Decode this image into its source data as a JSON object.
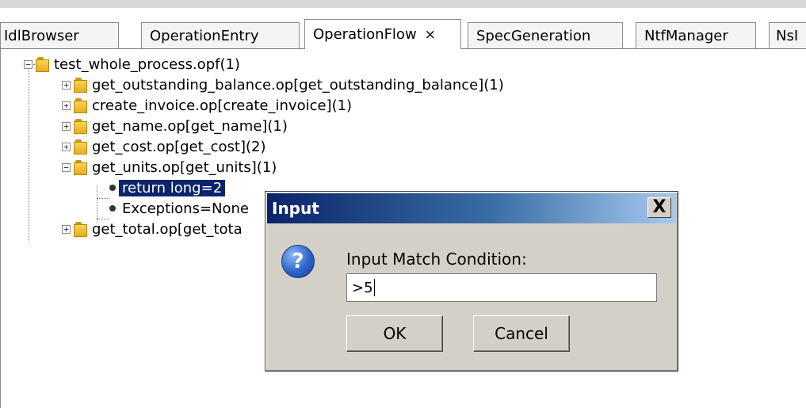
{
  "tabs": [
    {
      "label": "IdlBrowser"
    },
    {
      "label": "OperationEntry"
    },
    {
      "label": "OperationFlow",
      "close": "×"
    },
    {
      "label": "SpecGeneration"
    },
    {
      "label": "NtfManager"
    },
    {
      "label": "NsI"
    }
  ],
  "tree": {
    "root": {
      "label": "test_whole_process.opf(1)"
    },
    "children": [
      {
        "label": "get_outstanding_balance.op[get_outstanding_balance](1)",
        "expander": "+"
      },
      {
        "label": "create_invoice.op[create_invoice](1)",
        "expander": "+"
      },
      {
        "label": "get_name.op[get_name](1)",
        "expander": "+"
      },
      {
        "label": "get_cost.op[get_cost](2)",
        "expander": "+"
      },
      {
        "label": "get_units.op[get_units](1)",
        "expander": "−"
      },
      {
        "label": "return long=2"
      },
      {
        "label": "Exceptions=None"
      },
      {
        "label": "get_total.op[get_tota",
        "expander": "+"
      }
    ],
    "root_expander": "−"
  },
  "dialog": {
    "title": "Input",
    "close": "X",
    "question_glyph": "?",
    "prompt": "Input Match Condition:",
    "input_value": ">5",
    "ok": "OK",
    "cancel": "Cancel"
  }
}
